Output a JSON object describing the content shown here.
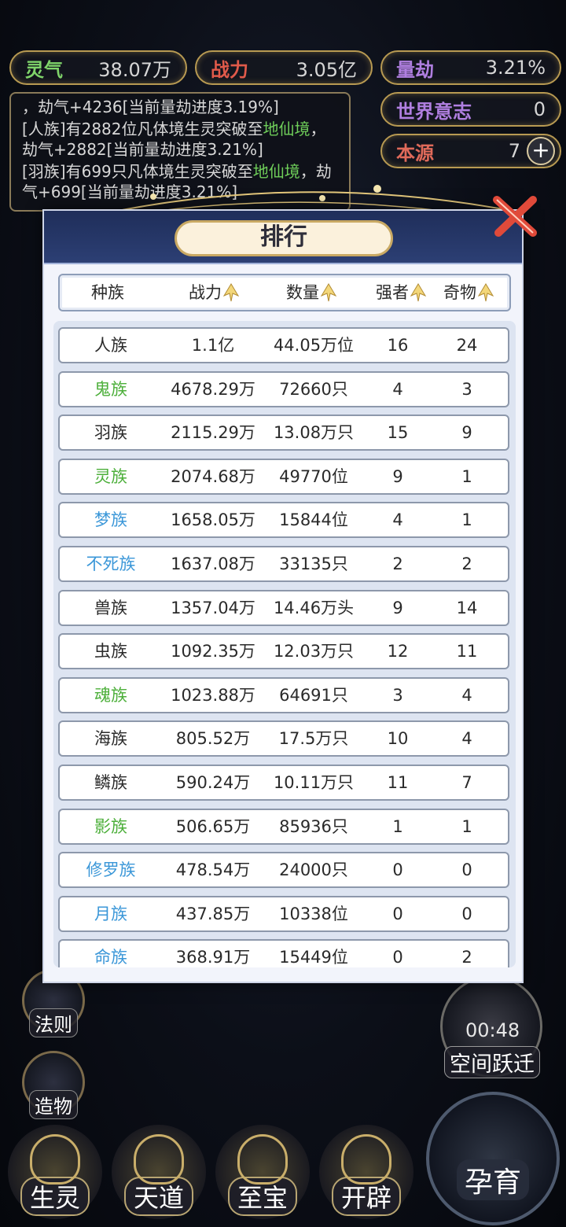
{
  "top_stats": {
    "lingqi": {
      "label": "灵气",
      "value": "38.07万"
    },
    "zhanli": {
      "label": "战力",
      "value": "3.05亿"
    },
    "liangjie": {
      "label": "量劫",
      "value": "3.21%"
    },
    "shijie_yizhi": {
      "label": "世界意志",
      "value": "0"
    },
    "benyuan": {
      "label": "本源",
      "value": "7",
      "plus": "+"
    }
  },
  "log": {
    "lines": [
      {
        "parts": [
          {
            "text": "，劫气+4236[当前量劫进度3.19%]",
            "color": "normal"
          }
        ]
      },
      {
        "parts": [
          {
            "text": "[人族]有2882位凡体境生灵突破至",
            "color": "normal"
          },
          {
            "text": "地仙境",
            "color": "green"
          },
          {
            "text": "，劫气+2882[当前量劫进度3.21%]",
            "color": "normal"
          }
        ]
      },
      {
        "parts": [
          {
            "text": "[羽族]有699只凡体境生灵突破至",
            "color": "normal"
          },
          {
            "text": "地仙境",
            "color": "green"
          },
          {
            "text": "，劫气+699[当前量劫进度3.21%]",
            "color": "normal"
          }
        ]
      }
    ]
  },
  "side_menu": {
    "fazhe": "法则",
    "zaowu": "造物"
  },
  "timer": {
    "time": "00:48",
    "label": "空间跃迁"
  },
  "bottom_nav": {
    "shengling": "生灵",
    "tiandao": "天道",
    "zhibao": "至宝",
    "kaipi": "开辟",
    "yunyu": "孕育"
  },
  "modal": {
    "title": "排行",
    "columns": {
      "race": "种族",
      "power": "战力",
      "count": "数量",
      "strong": "强者",
      "items": "奇物"
    },
    "rows": [
      {
        "race": "人族",
        "power": "1.1亿",
        "count": "44.05万位",
        "strong": "16",
        "items": "24",
        "tier": "normal"
      },
      {
        "race": "鬼族",
        "power": "4678.29万",
        "count": "72660只",
        "strong": "4",
        "items": "3",
        "tier": "green"
      },
      {
        "race": "羽族",
        "power": "2115.29万",
        "count": "13.08万只",
        "strong": "15",
        "items": "9",
        "tier": "normal"
      },
      {
        "race": "灵族",
        "power": "2074.68万",
        "count": "49770位",
        "strong": "9",
        "items": "1",
        "tier": "green"
      },
      {
        "race": "梦族",
        "power": "1658.05万",
        "count": "15844位",
        "strong": "4",
        "items": "1",
        "tier": "blue"
      },
      {
        "race": "不死族",
        "power": "1637.08万",
        "count": "33135只",
        "strong": "2",
        "items": "2",
        "tier": "blue"
      },
      {
        "race": "兽族",
        "power": "1357.04万",
        "count": "14.46万头",
        "strong": "9",
        "items": "14",
        "tier": "normal"
      },
      {
        "race": "虫族",
        "power": "1092.35万",
        "count": "12.03万只",
        "strong": "12",
        "items": "11",
        "tier": "normal"
      },
      {
        "race": "魂族",
        "power": "1023.88万",
        "count": "64691只",
        "strong": "3",
        "items": "4",
        "tier": "green"
      },
      {
        "race": "海族",
        "power": "805.52万",
        "count": "17.5万只",
        "strong": "10",
        "items": "4",
        "tier": "normal"
      },
      {
        "race": "鳞族",
        "power": "590.24万",
        "count": "10.11万只",
        "strong": "11",
        "items": "7",
        "tier": "normal"
      },
      {
        "race": "影族",
        "power": "506.65万",
        "count": "85936只",
        "strong": "1",
        "items": "1",
        "tier": "green"
      },
      {
        "race": "修罗族",
        "power": "478.54万",
        "count": "24000只",
        "strong": "0",
        "items": "0",
        "tier": "blue"
      },
      {
        "race": "月族",
        "power": "437.85万",
        "count": "10338位",
        "strong": "0",
        "items": "0",
        "tier": "blue"
      },
      {
        "race": "命族",
        "power": "368.91万",
        "count": "15449位",
        "strong": "0",
        "items": "2",
        "tier": "blue"
      }
    ]
  },
  "colors": {
    "green_tier": "#4caf3a",
    "blue_tier": "#3b97d8",
    "gold": "#c9a963"
  },
  "icons": [
    "arrow-up-icon",
    "close-icon",
    "plus-icon"
  ]
}
